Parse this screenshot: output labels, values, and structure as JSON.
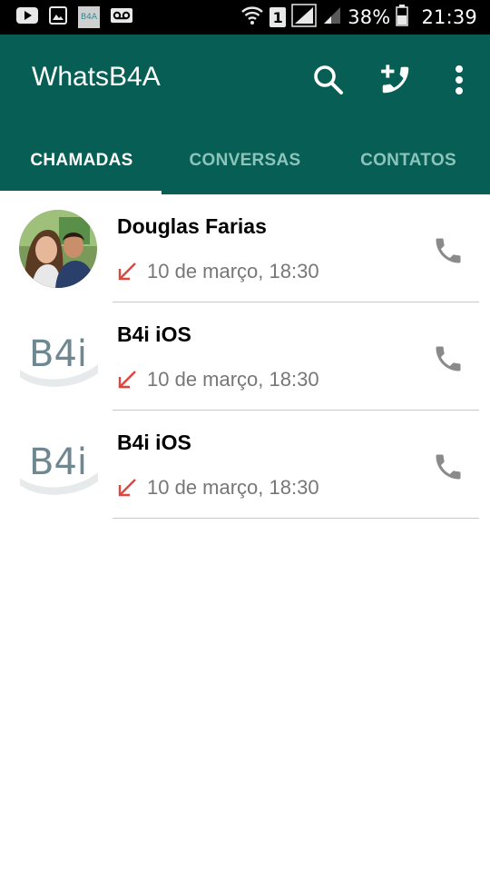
{
  "status_bar": {
    "icons": [
      "youtube-icon",
      "gallery-icon",
      "b4a-app-icon",
      "voicemail-icon",
      "wifi-icon",
      "sim-1-icon",
      "signal-icon",
      "signal-secondary-icon",
      "battery-icon"
    ],
    "sim_label": "1",
    "b4a_label": "B4A",
    "battery": "38%",
    "time": "21:39"
  },
  "app_bar": {
    "title": "WhatsB4A",
    "actions": [
      "search-icon",
      "add-call-icon",
      "more-vert-icon"
    ]
  },
  "tabs": [
    {
      "label": "CHAMADAS",
      "active": true
    },
    {
      "label": "CONVERSAS",
      "active": false
    },
    {
      "label": "CONTATOS",
      "active": false
    }
  ],
  "calls": [
    {
      "name": "Douglas Farias",
      "time": "10 de março, 18:30",
      "direction": "incoming-missed",
      "avatar": "photo"
    },
    {
      "name": "B4i iOS",
      "time": "10 de março, 18:30",
      "direction": "incoming-missed",
      "avatar": "b4i-logo",
      "logo_text": "B4i"
    },
    {
      "name": "B4i iOS",
      "time": "10 de março, 18:30",
      "direction": "incoming-missed",
      "avatar": "b4i-logo",
      "logo_text": "B4i"
    }
  ],
  "colors": {
    "primary": "#075e54",
    "status_bar": "#000000",
    "tab_inactive": "#8cc4bb",
    "missed_arrow": "#e0443e",
    "call_icon": "#8a8a8a",
    "secondary_text": "#777777"
  }
}
